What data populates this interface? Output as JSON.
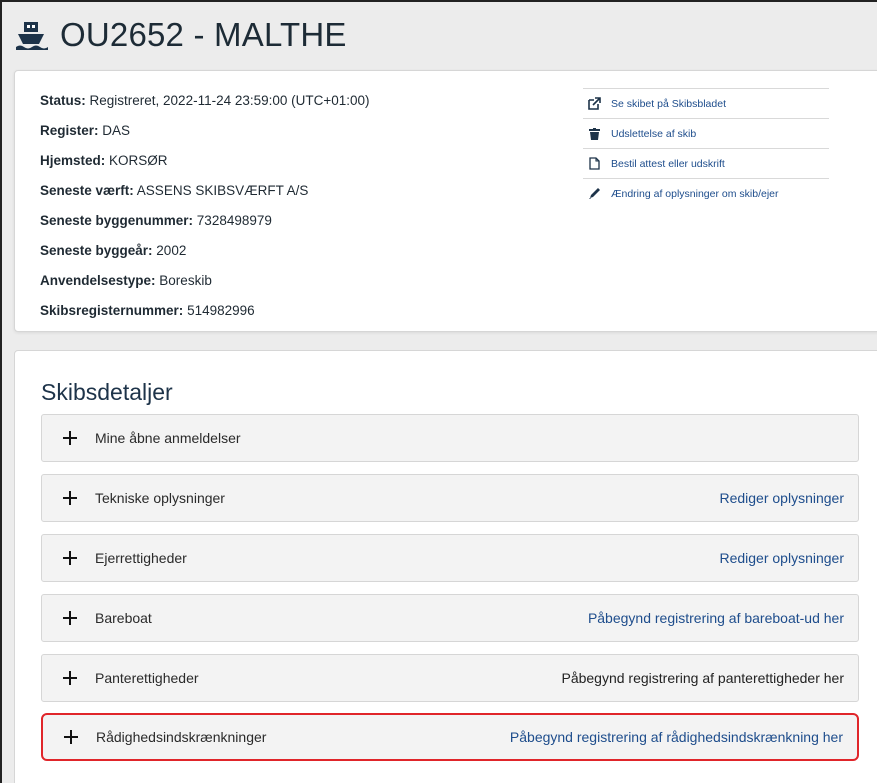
{
  "header": {
    "title": "OU2652 - MALTHE",
    "icon": "ship-icon"
  },
  "info": {
    "rows": [
      {
        "label": "Status:",
        "value": " Registreret, 2022-11-24 23:59:00 (UTC+01:00)"
      },
      {
        "label": "Register:",
        "value": " DAS"
      },
      {
        "label": "Hjemsted:",
        "value": " KORSØR"
      },
      {
        "label": "Seneste værft:",
        "value": " ASSENS SKIBSVÆRFT A/S"
      },
      {
        "label": "Seneste byggenummer:",
        "value": " 7328498979"
      },
      {
        "label": "Seneste byggeår:",
        "value": " 2002"
      },
      {
        "label": "Anvendelsestype:",
        "value": " Boreskib"
      },
      {
        "label": "Skibsregisternummer:",
        "value": " 514982996"
      }
    ]
  },
  "actions": [
    {
      "label": "Se skibet på Skibsbladet",
      "icon": "external-link-icon"
    },
    {
      "label": "Udslettelse af skib",
      "icon": "trash-icon"
    },
    {
      "label": "Bestil attest eller udskrift",
      "icon": "document-icon"
    },
    {
      "label": "Ændring af oplysninger om skib/ejer",
      "icon": "pencil-icon"
    }
  ],
  "details": {
    "title": "Skibsdetaljer",
    "accordions": [
      {
        "label": "Mine åbne anmeldelser",
        "link": ""
      },
      {
        "label": "Tekniske oplysninger",
        "link": "Rediger oplysninger"
      },
      {
        "label": "Ejerrettigheder",
        "link": "Rediger oplysninger"
      },
      {
        "label": "Bareboat",
        "link": "Påbegynd registrering af bareboat-ud her"
      },
      {
        "label": "Panterettigheder",
        "link": "Påbegynd registrering af panterettigheder her"
      },
      {
        "label": "Rådighedsindskrænkninger",
        "link": "Påbegynd registrering af rådighedsindskrænkning her"
      }
    ]
  },
  "colors": {
    "link": "#1e4d8c",
    "highlight": "#e0252a",
    "panel": "#f3f3f3"
  }
}
